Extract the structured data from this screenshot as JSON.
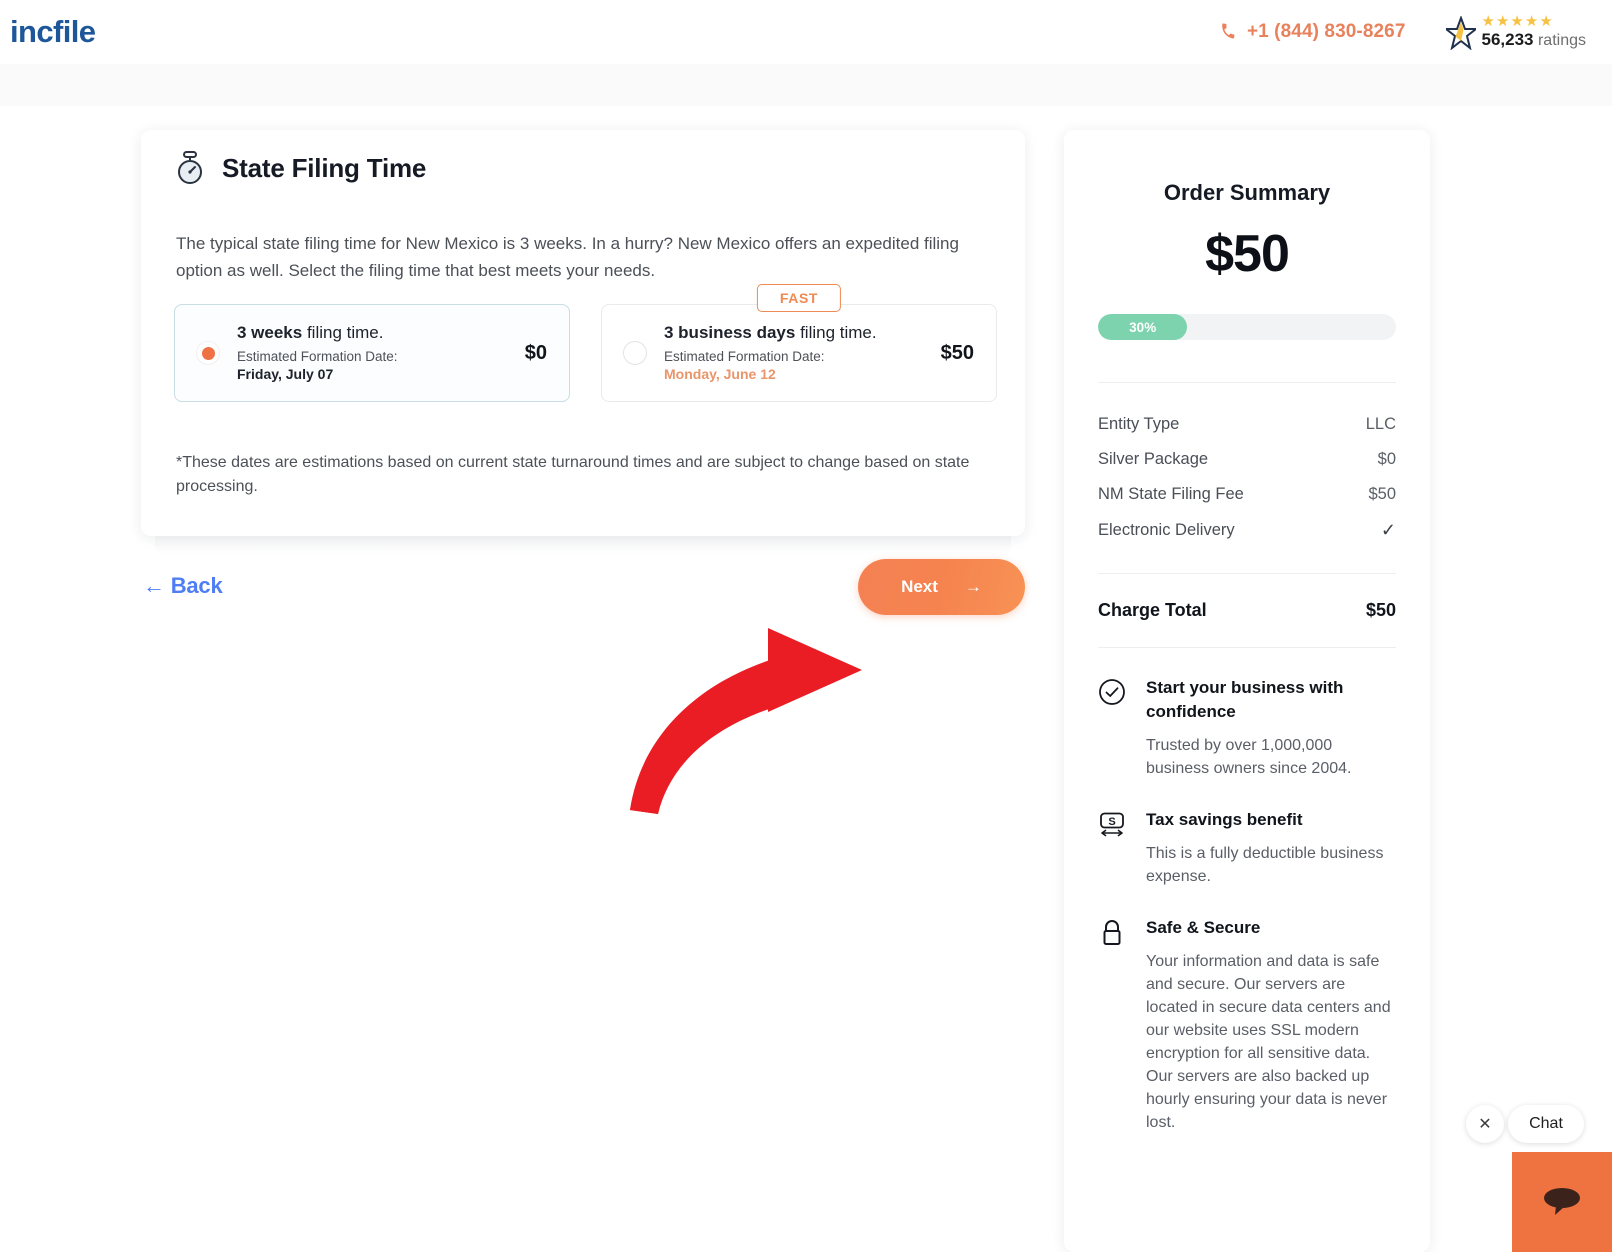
{
  "header": {
    "logo": "incfile",
    "phone": "+1 (844) 830-8267",
    "phone_icon": "phone-icon",
    "rating_count": "56,233",
    "rating_word": "ratings",
    "stars": 5,
    "star_color": "#f5c243",
    "phone_color": "#e8825c"
  },
  "main": {
    "icon": "stopwatch-icon",
    "title": "State Filing Time",
    "description": "The typical state filing time for New Mexico is 3 weeks. In a hurry? New Mexico offers an expedited filing option as well. Select the filing time that best meets your needs.",
    "footnote": "*These dates are estimations based on current state turnaround times and are subject to change based on state processing.",
    "options": [
      {
        "id": "standard",
        "selected": true,
        "highlight": "3 weeks",
        "rest": " filing time.",
        "date_label": "Estimated Formation Date:",
        "date_value": "Friday, July 07",
        "price": "$0",
        "badge": null
      },
      {
        "id": "expedited",
        "selected": false,
        "highlight": "3 business days",
        "rest": " filing time.",
        "date_label": "Estimated Formation Date:",
        "date_value": "Monday, June 12",
        "price": "$50",
        "badge": "FAST"
      }
    ],
    "back_label": "← Back",
    "next_label": "Next",
    "next_arrow": "→",
    "next_color": "#f5834f",
    "back_color": "#4f7df3"
  },
  "summary": {
    "title": "Order Summary",
    "amount": "$50",
    "progress_label": "30%",
    "progress_percent": 30,
    "progress_color": "#7dd3ae",
    "rows": [
      {
        "label": "Entity Type",
        "value": "LLC"
      },
      {
        "label": "Silver Package",
        "value": "$0"
      },
      {
        "label": "NM State Filing Fee",
        "value": "$50"
      },
      {
        "label": "Electronic Delivery",
        "value": "✓"
      }
    ],
    "total_label": "Charge Total",
    "total_value": "$50",
    "trust": [
      {
        "icon": "check-circle-icon",
        "title": "Start your business with confidence",
        "text": "Trusted by over 1,000,000 business owners since 2004."
      },
      {
        "icon": "tax-savings-icon",
        "title": "Tax savings benefit",
        "text": "This is a fully deductible business expense."
      },
      {
        "icon": "lock-icon",
        "title": "Safe & Secure",
        "text": "Your information and data is safe and secure. Our servers are located in secure data centers and our website uses SSL modern encryption for all sensitive data. Our servers are also backed up hourly ensuring your data is never lost."
      }
    ]
  },
  "chat": {
    "close_icon": "close-icon",
    "label": "Chat",
    "launcher_icon": "chat-bubble-icon",
    "launcher_color": "#ef7340"
  }
}
